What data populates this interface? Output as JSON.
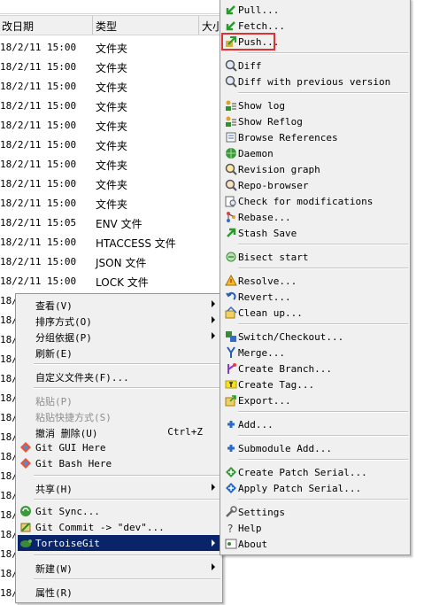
{
  "explorer": {
    "headers": [
      "改日期",
      "类型",
      "大小"
    ],
    "rows": [
      {
        "date": "18/2/11 15:00",
        "type": "文件夹"
      },
      {
        "date": "18/2/11 15:00",
        "type": "文件夹"
      },
      {
        "date": "18/2/11 15:00",
        "type": "文件夹"
      },
      {
        "date": "18/2/11 15:00",
        "type": "文件夹"
      },
      {
        "date": "18/2/11 15:00",
        "type": "文件夹"
      },
      {
        "date": "18/2/11 15:00",
        "type": "文件夹"
      },
      {
        "date": "18/2/11 15:00",
        "type": "文件夹"
      },
      {
        "date": "18/2/11 15:00",
        "type": "文件夹"
      },
      {
        "date": "18/2/11 15:00",
        "type": "文件夹"
      },
      {
        "date": "18/2/11 15:05",
        "type": "ENV 文件"
      },
      {
        "date": "18/2/11 15:00",
        "type": "HTACCESS 文件"
      },
      {
        "date": "18/2/11 15:00",
        "type": "JSON 文件"
      },
      {
        "date": "18/2/11 15:00",
        "type": "LOCK 文件"
      }
    ],
    "partial_rows": [
      "18/",
      "18/",
      "18/",
      "18/",
      "18/",
      "18/",
      "18/",
      "18/",
      "18/",
      "18/",
      "18/",
      "18/",
      "18/",
      "18/",
      "18/",
      "18/"
    ]
  },
  "context_menu": {
    "items": [
      {
        "label": "查看(V)"
      },
      {
        "label": "排序方式(O)"
      },
      {
        "label": "分组依据(P)"
      },
      {
        "label": "刷新(E)"
      },
      {
        "label": "自定义文件夹(F)..."
      },
      {
        "label": "粘贴(P)"
      },
      {
        "label": "粘贴快捷方式(S)"
      },
      {
        "label": "撤消 删除(U)",
        "shortcut": "Ctrl+Z"
      },
      {
        "label": "Git GUI Here"
      },
      {
        "label": "Git Bash Here"
      },
      {
        "label": "共享(H)"
      },
      {
        "label": "Git Sync..."
      },
      {
        "label": "Git Commit -> \"dev\"..."
      },
      {
        "label": "TortoiseGit"
      },
      {
        "label": "新建(W)"
      },
      {
        "label": "属性(R)"
      }
    ]
  },
  "tortoise_menu": {
    "items": [
      {
        "label": "Pull..."
      },
      {
        "label": "Fetch..."
      },
      {
        "label": "Push..."
      },
      {
        "label": "Diff"
      },
      {
        "label": "Diff with previous version"
      },
      {
        "label": "Show log"
      },
      {
        "label": "Show Reflog"
      },
      {
        "label": "Browse References"
      },
      {
        "label": "Daemon"
      },
      {
        "label": "Revision graph"
      },
      {
        "label": "Repo-browser"
      },
      {
        "label": "Check for modifications"
      },
      {
        "label": "Rebase..."
      },
      {
        "label": "Stash Save"
      },
      {
        "label": "Bisect start"
      },
      {
        "label": "Resolve..."
      },
      {
        "label": "Revert..."
      },
      {
        "label": "Clean up..."
      },
      {
        "label": "Switch/Checkout..."
      },
      {
        "label": "Merge..."
      },
      {
        "label": "Create Branch..."
      },
      {
        "label": "Create Tag..."
      },
      {
        "label": "Export..."
      },
      {
        "label": "Add..."
      },
      {
        "label": "Submodule Add..."
      },
      {
        "label": "Create Patch Serial..."
      },
      {
        "label": "Apply Patch Serial..."
      },
      {
        "label": "Settings"
      },
      {
        "label": "Help"
      },
      {
        "label": "About"
      }
    ]
  },
  "colors": {
    "selection": "#0a246a",
    "highlight_box": "#e03030",
    "menu_bg": "#f0f0f0"
  }
}
